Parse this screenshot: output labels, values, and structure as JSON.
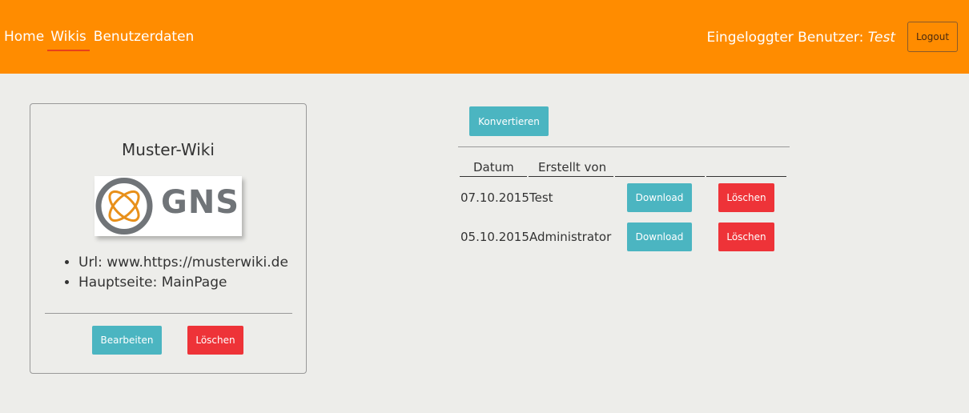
{
  "nav": {
    "items": [
      {
        "label": "Home",
        "active": false
      },
      {
        "label": "Wikis",
        "active": true
      },
      {
        "label": "Benutzerdaten",
        "active": false
      }
    ]
  },
  "user": {
    "prefix": "Eingeloggter Benutzer:",
    "name": "Test",
    "logout_label": "Logout"
  },
  "wiki_card": {
    "title": "Muster-Wiki",
    "logo_text": "GNS",
    "details": [
      "Url: www.https://musterwiki.de",
      "Hauptseite: MainPage"
    ],
    "edit_label": "Bearbeiten",
    "delete_label": "Löschen"
  },
  "conversions": {
    "convert_label": "Konvertieren",
    "columns": [
      "Datum",
      "Erstellt von",
      "",
      ""
    ],
    "rows": [
      {
        "date": "07.10.2015",
        "creator": "Test",
        "download_label": "Download",
        "delete_label": "Löschen"
      },
      {
        "date": "05.10.2015",
        "creator": "Administrator",
        "download_label": "Download",
        "delete_label": "Löschen"
      }
    ]
  },
  "colors": {
    "header": "#ff8c00",
    "background": "#ededea",
    "teal": "#4bb5c1",
    "red": "#ee3338",
    "logo_orange": "#e8901a",
    "logo_gray": "#707478"
  }
}
